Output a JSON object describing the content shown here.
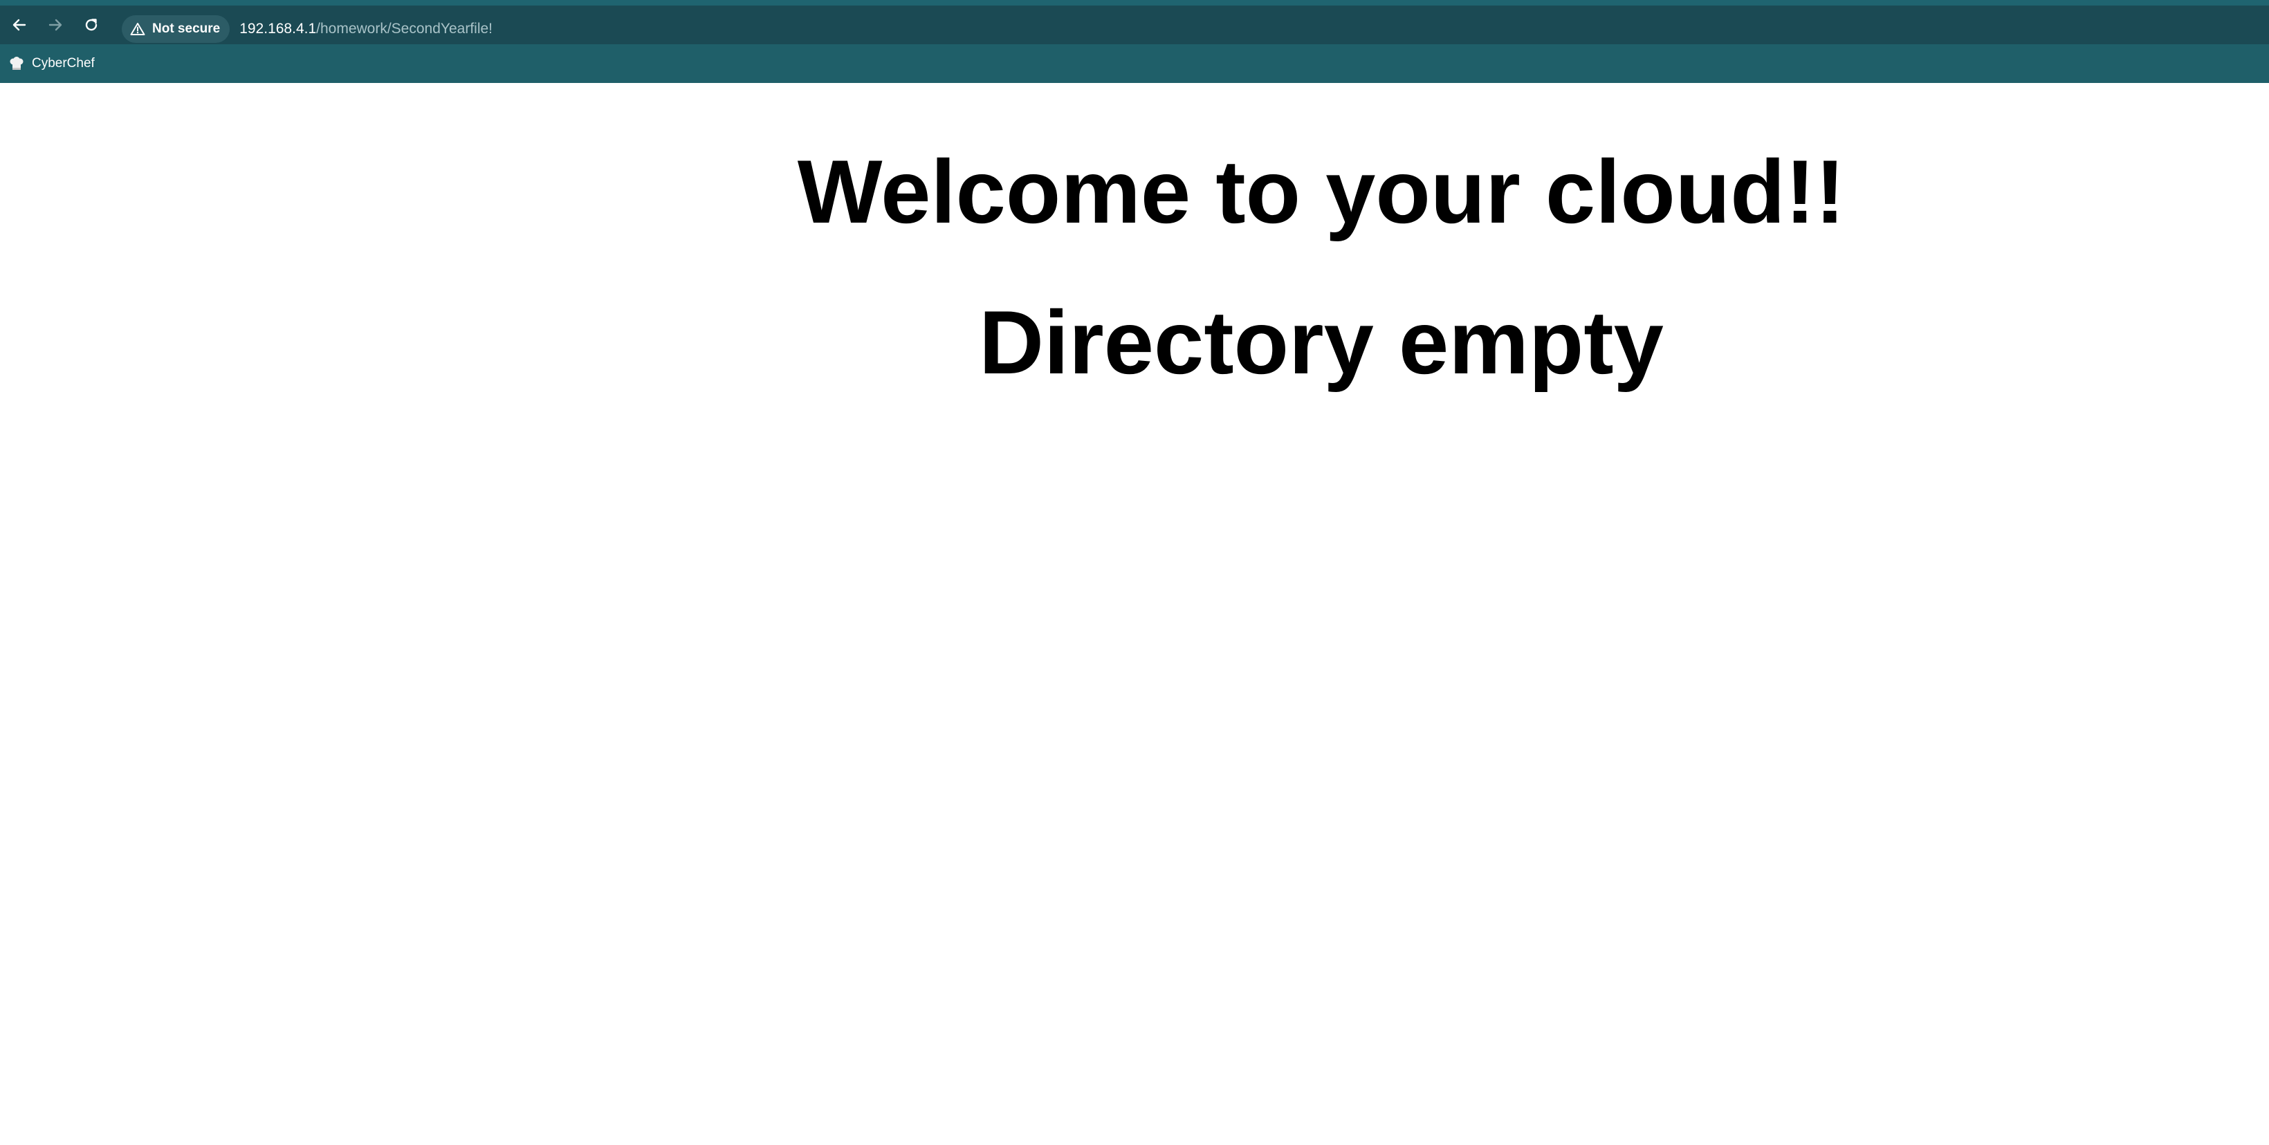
{
  "browser": {
    "security_label": "Not secure",
    "url_host": "192.168.4.1",
    "url_path": "/homework/SecondYearfile!",
    "nav": {
      "back_icon": "arrow-left-icon",
      "forward_icon": "arrow-right-icon",
      "reload_icon": "reload-icon"
    },
    "colors": {
      "toolbar": "#1b4a54",
      "bookmarks_bar": "#1f5f69"
    }
  },
  "bookmarks": [
    {
      "label": "CyberChef",
      "icon": "chef-hat-icon"
    }
  ],
  "page": {
    "heading": "Welcome to your cloud!!",
    "status": "Directory empty"
  }
}
